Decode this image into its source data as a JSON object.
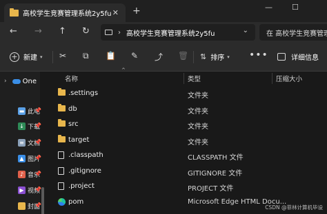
{
  "window": {
    "tab_title": "高校学生竞赛管理系统2y5fu",
    "close_tab": "✕",
    "new_tab": "+",
    "minimize": "—",
    "maximize": "☐"
  },
  "navigation": {
    "back": "←",
    "forward": "→",
    "up": "↑",
    "refresh": "↻",
    "address_sep": "›",
    "address_text": "高校学生竞赛管理系统2y5fu",
    "address_drop": "⌄",
    "search_text": "在 高校学生竞赛管理"
  },
  "commands": {
    "new_label": "新建",
    "new_plus": "+",
    "caret": "▾",
    "cut": "✂",
    "copy": "⧉",
    "paste": "📋",
    "rename": "✎",
    "share": "⤴",
    "delete": "🗑",
    "sort_icon": "⇅",
    "sort_label": "排序",
    "more": "•••",
    "details_label": "详细信息"
  },
  "sidebar": {
    "chevron": "›",
    "onedrive_label": "One",
    "pin": "📌",
    "items": [
      {
        "label": "此电",
        "icon": "▬",
        "color": "#5aa0e6"
      },
      {
        "label": "下载",
        "icon": "↓",
        "color": "#2e8b57"
      },
      {
        "label": "文档",
        "icon": "≡",
        "color": "#8aa0b8"
      },
      {
        "label": "图片",
        "icon": "▲",
        "color": "#3a8ee6"
      },
      {
        "label": "音乐",
        "icon": "♪",
        "color": "#e0604a"
      },
      {
        "label": "视频",
        "icon": "▶",
        "color": "#8a4fd1"
      },
      {
        "label": "封面",
        "icon": "",
        "color": "#e8b64c"
      }
    ]
  },
  "file_list": {
    "sort_indicator": "^",
    "columns": {
      "name": "名称",
      "type": "类型",
      "size": "压缩大小"
    },
    "rows": [
      {
        "name": ".settings",
        "type": "文件夹",
        "icon": "folder"
      },
      {
        "name": "db",
        "type": "文件夹",
        "icon": "folder"
      },
      {
        "name": "src",
        "type": "文件夹",
        "icon": "folder"
      },
      {
        "name": "target",
        "type": "文件夹",
        "icon": "folder"
      },
      {
        "name": ".classpath",
        "type": "CLASSPATH 文件",
        "icon": "file"
      },
      {
        "name": ".gitignore",
        "type": "GITIGNORE 文件",
        "icon": "file"
      },
      {
        "name": ".project",
        "type": "PROJECT 文件",
        "icon": "file"
      },
      {
        "name": "pom",
        "type": "Microsoft Edge HTML Docu...",
        "icon": "edge"
      }
    ]
  },
  "watermark": "CSDN @菲林计算机毕设"
}
